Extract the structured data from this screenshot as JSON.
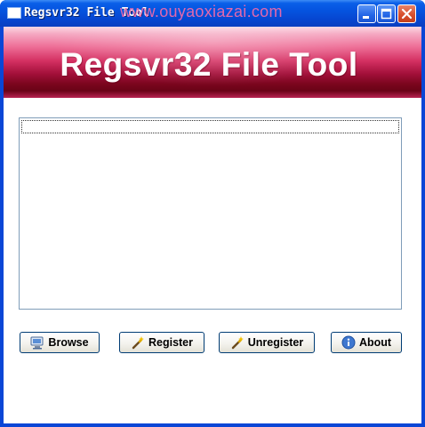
{
  "window": {
    "title": "Regsvr32 File Tool",
    "watermark": "www.ouyaoxiazai.com"
  },
  "banner": {
    "title": "Regsvr32 File Tool"
  },
  "file_list": {
    "items": []
  },
  "buttons": {
    "browse": "Browse",
    "register": "Register",
    "unregister": "Unregister",
    "about": "About"
  },
  "icons": {
    "app": "window-icon",
    "browse": "computer-icon",
    "register": "wand-icon",
    "unregister": "wand-icon",
    "about": "info-icon"
  },
  "colors": {
    "titlebar": "#0553df",
    "banner_dark": "#7c061f",
    "banner_light": "#f5a9c2",
    "watermark": "#ee6aaa"
  }
}
